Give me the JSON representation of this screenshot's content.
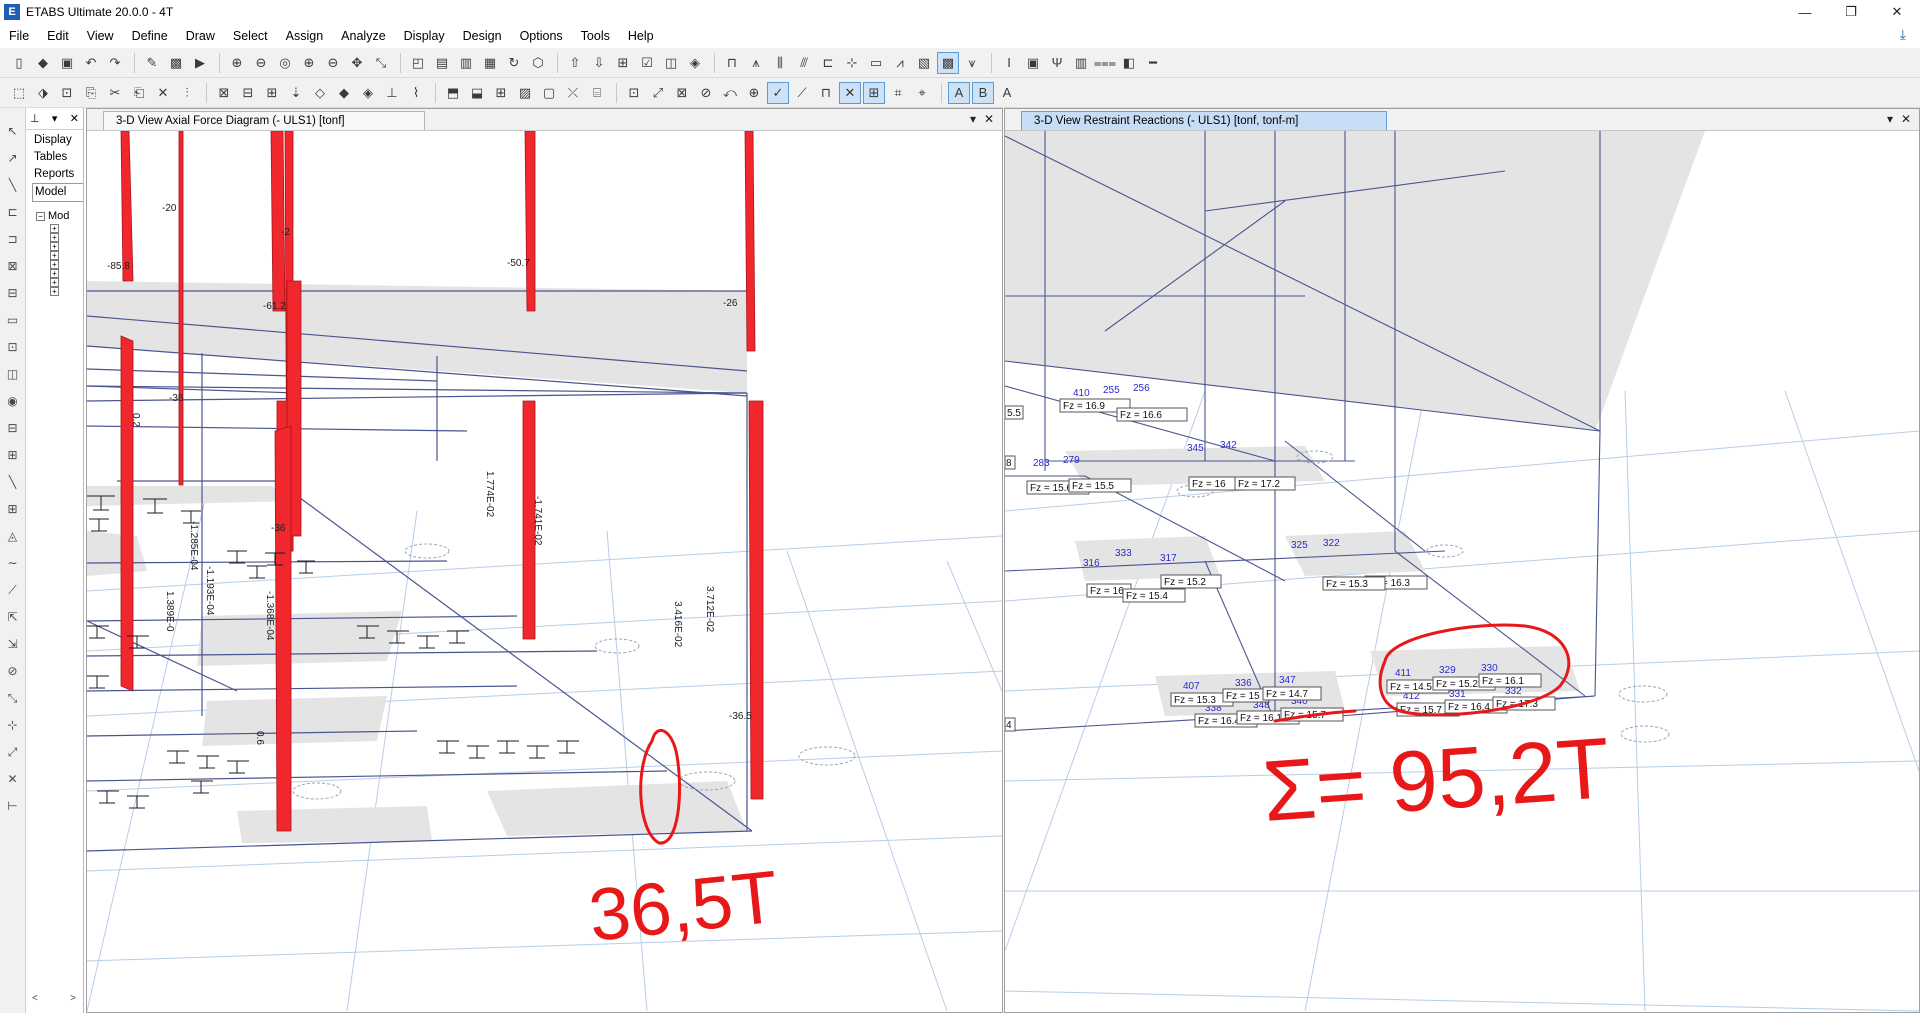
{
  "window": {
    "logo": "E",
    "title": "ETABS Ultimate 20.0.0 - 4T",
    "minimize_icon": "—",
    "restore_icon": "❐",
    "close_icon": "✕"
  },
  "menu": {
    "items": [
      "File",
      "Edit",
      "View",
      "Define",
      "Draw",
      "Select",
      "Assign",
      "Analyze",
      "Display",
      "Design",
      "Options",
      "Tools",
      "Help"
    ],
    "download_icon": "⤓"
  },
  "explorer": {
    "pin_icon": "⊥",
    "dropdown_icon": "▾",
    "close_icon": "✕",
    "tabs": [
      "Display",
      "Tables",
      "Reports",
      "Model"
    ],
    "tree_root_toggle": "−",
    "tree_root": "Mod",
    "tree_child_toggle": "+",
    "scroll_left": "<",
    "scroll_right": ">"
  },
  "left_pane": {
    "tab_title": "3-D View   Axial Force Diagram   (- ULS1)  [tonf]",
    "dropdown_icon": "▾",
    "close_icon": "✕",
    "labels": {
      "a": "-20",
      "b": "-85.8",
      "c": "-2",
      "d": "-50.7",
      "e": "-61.2",
      "f": "-26",
      "g": "-36",
      "h": "0.2",
      "i": "-1.285E-04",
      "j": "-1.193E-04",
      "k": "1.389E-0",
      "l": "-1.368E-04",
      "m": "1.774E-02",
      "n": "-1.741E-02",
      "o": "3.712E-02",
      "p": "3.416E-02",
      "q": "-36",
      "r": "0.6",
      "s": "-36.5"
    },
    "annotation": "36,5T"
  },
  "right_pane": {
    "tab_title": "3-D View   Restraint Reactions    (- ULS1)  [tonf, tonf-m]",
    "dropdown_icon": "▾",
    "close_icon": "✕",
    "nodes": [
      "410",
      "255",
      "256",
      "345",
      "342",
      "283",
      "279",
      "316",
      "333",
      "317",
      "325",
      "322",
      "407",
      "336",
      "347",
      "411",
      "329",
      "330",
      "338",
      "348",
      "340",
      "412",
      "331",
      "332"
    ],
    "reactions": {
      "r1": "Fz = 16.9",
      "r2": "Fz = 16.6",
      "r3": "Fz = 15.6",
      "r4": "Fz = 15.5",
      "r5": "Fz = 16",
      "r6": "Fz = 17.2",
      "r7": "Fz = 16",
      "r8": "Fz = 15.2",
      "r9": "Fz = 15.4",
      "r10": "Fz = 16.3",
      "r11": "Fz = 15.3",
      "r12": "Fz = 15.3",
      "r13": "Fz = 15",
      "r14": "Fz = 14.7",
      "r15": "Fz = 16.4",
      "r16": "Fz = 16.1",
      "r17": "Fz = 15.7",
      "r18": "Fz = 14.5",
      "r19": "Fz = 15.2",
      "r20": "Fz = 16.1",
      "r21": "Fz = 15.7",
      "r22": "Fz = 16.4",
      "r23": "Fz = 17.3"
    },
    "edge_labels": [
      "5.5",
      "8",
      "4"
    ],
    "annotation": "Σ= 95,2T"
  },
  "colors": {
    "axial_bar": "#f0282d",
    "frame_line": "#4a5590",
    "grid_line": "#b7cde8",
    "slab_fill": "#e4e4e4",
    "node_label": "#2a2ad0",
    "markup": "#e81818"
  }
}
